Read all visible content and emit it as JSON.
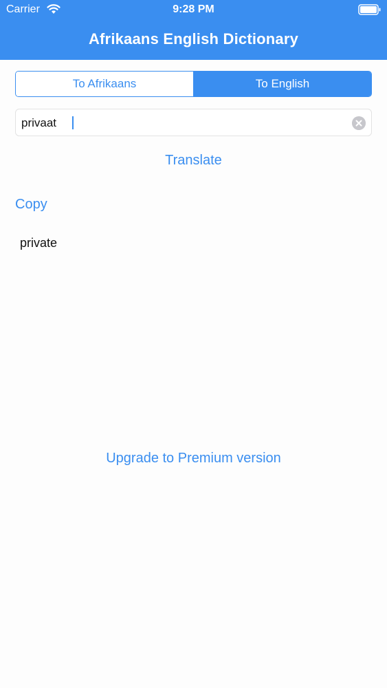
{
  "status_bar": {
    "carrier": "Carrier",
    "time": "9:28 PM"
  },
  "nav": {
    "title": "Afrikaans English Dictionary"
  },
  "direction": {
    "options": [
      "To Afrikaans",
      "To English"
    ],
    "selected": "To English"
  },
  "search": {
    "value": "privaat"
  },
  "actions": {
    "translate_label": "Translate",
    "copy_label": "Copy",
    "upgrade_label": "Upgrade to Premium version"
  },
  "result": {
    "text": "private"
  },
  "colors": {
    "accent": "#3a8ef0",
    "header_bg": "#3a8ef0",
    "clear_icon": "#c7c7cc"
  }
}
